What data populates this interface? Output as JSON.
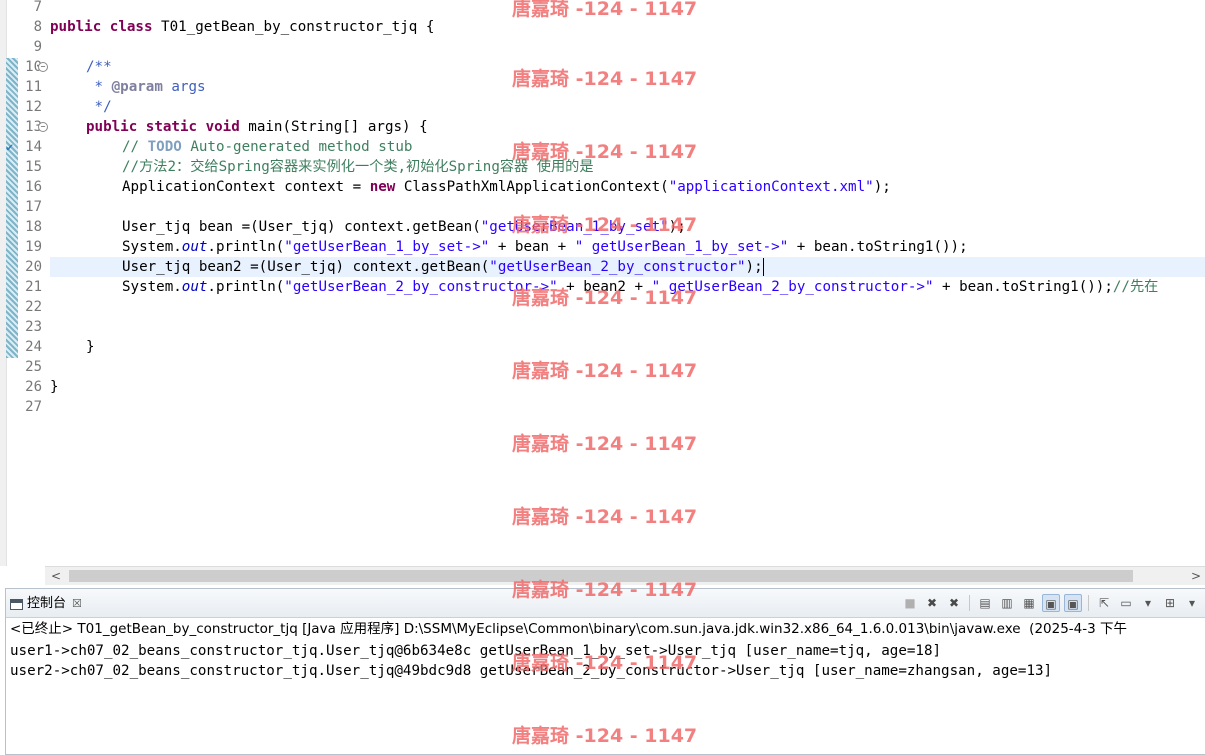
{
  "editor": {
    "line_numbers": [
      "7",
      "8",
      "9",
      "10",
      "11",
      "12",
      "13",
      "14",
      "15",
      "16",
      "17",
      "18",
      "19",
      "20",
      "21",
      "22",
      "23",
      "24",
      "25",
      "26",
      "27"
    ],
    "lines": {
      "l8": [
        "public",
        " ",
        "class",
        " T01_getBean_by_constructor_tjq {"
      ],
      "l10": "/**",
      "l11_star": " * ",
      "l11_tag": "@param",
      "l11_arg": " args",
      "l12": " */",
      "l13_a": "public",
      "l13_b": "static",
      "l13_c": "void",
      "l13_d": " main(String[] args) {",
      "l14_a": "// ",
      "l14_todo": "TODO",
      "l14_b": " Auto-generated method stub",
      "l15": "//方法2：交给Spring容器来实例化一个类,初始化Spring容器 使用的是",
      "l16_a": "ApplicationContext context = ",
      "l16_new": "new",
      "l16_b": " ClassPathXmlApplicationContext(",
      "l16_str": "\"applicationContext.xml\"",
      "l16_c": ");",
      "l18_a": "User_tjq bean =(User_tjq) context.getBean(",
      "l18_str": "\"getUserBean_1_by_set\"",
      "l18_b": ");",
      "l19_a": "System.",
      "l19_out": "out",
      "l19_b": ".println(",
      "l19_str1": "\"getUserBean_1_by_set->\"",
      "l19_c": " + bean + ",
      "l19_str2": "\" getUserBean_1_by_set->\"",
      "l19_d": " + bean.toString1());",
      "l20_a": "User_tjq bean2 =(User_tjq) context.getBean(",
      "l20_str": "\"getUserBean_2_by_constructor\"",
      "l20_b": ");",
      "l21_a": "System.",
      "l21_out": "out",
      "l21_b": ".println(",
      "l21_str1": "\"getUserBean_2_by_constructor->\"",
      "l21_c": " + bean2 + ",
      "l21_str2": "\" getUserBean_2_by_constructor->\"",
      "l21_d": " + bean.toString1());",
      "l21_cmt": "//先在",
      "l24": "}",
      "l26": "}"
    }
  },
  "console": {
    "tab_label": "控制台",
    "tab_close": "☒",
    "status": "<已终止> T01_getBean_by_constructor_tjq [Java 应用程序] D:\\SSM\\MyEclipse\\Common\\binary\\com.sun.java.jdk.win32.x86_64_1.6.0.013\\bin\\javaw.exe  (2025-4-3 下午",
    "output": [
      "user1->ch07_02_beans_constructor_tjq.User_tjq@6b634e8c getUserBean_1_by_set->User_tjq [user_name=tjq, age=18]",
      "user2->ch07_02_beans_constructor_tjq.User_tjq@49bdc9d8 getUserBean_2_by_constructor->User_tjq [user_name=zhangsan, age=13]"
    ],
    "toolbar_icons": [
      "terminate-icon",
      "remove-launch-icon",
      "remove-all-icon",
      "clear-console-icon",
      "scroll-lock-icon",
      "word-wrap-icon",
      "show-on-output-icon",
      "show-on-error-icon",
      "pin-console-icon",
      "display-console-icon",
      "open-console-icon",
      "view-menu-icon"
    ]
  },
  "watermark": {
    "text": "唐嘉琦 -124 - 1147",
    "color": "#f06a6a"
  }
}
